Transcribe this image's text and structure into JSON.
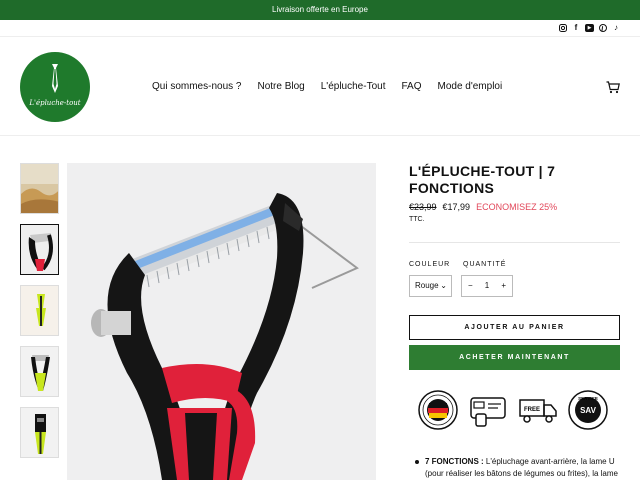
{
  "announcement": "Livraison offerte en Europe",
  "social": {
    "icons": [
      "instagram-icon",
      "facebook-icon",
      "youtube-icon",
      "pinterest-icon",
      "tiktok-icon"
    ]
  },
  "logo": {
    "text": "L'épluche-tout",
    "color": "#1f7a2c"
  },
  "nav": {
    "items": [
      "Qui sommes-nous ?",
      "Notre Blog",
      "L'épluche-Tout",
      "FAQ",
      "Mode d'emploi"
    ]
  },
  "product": {
    "title": "L'ÉPLUCHE-TOUT | 7 FONCTIONS",
    "old_price": "€23,99",
    "price": "€17,99",
    "savings": "ECONOMISEZ 25%",
    "tax_note": "TTC.",
    "color_label": "COULEUR",
    "color_value": "Rouge",
    "quantity_label": "QUANTITÉ",
    "quantity_value": "1",
    "minus": "−",
    "plus": "+",
    "add_to_cart": "AJOUTER AU PANIER",
    "buy_now": "ACHETER MAINTENANT"
  },
  "badges": [
    "made-in-germany-icon",
    "card-payment-icon",
    "free-shipping-icon",
    "service-sav-icon"
  ],
  "badge_text": {
    "free": "FREE",
    "sav": "SAV",
    "service": "SERVICE"
  },
  "features": {
    "item1_bold": "7 FONCTIONS :",
    "item1_text": " L'épluchage avant-arrière, la lame  U (pour réaliser les bâtons de légumes ou frites), la lame"
  },
  "colors": {
    "accent_green": "#1f6b2a",
    "button_green": "#2e7d32",
    "savings_red": "#e2475a",
    "product_red": "#e0213a"
  }
}
